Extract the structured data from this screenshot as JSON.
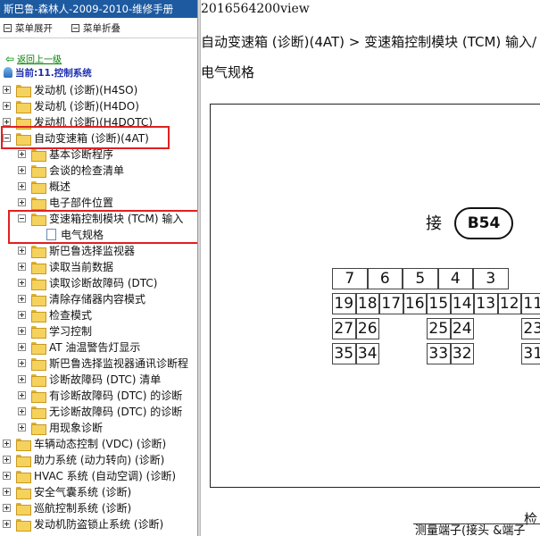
{
  "window": {
    "title": "斯巴鲁-森林人-2009-2010-维修手册"
  },
  "menubar": {
    "expand_label": "菜单展开",
    "collapse_label": "菜单折叠"
  },
  "nav": {
    "back_label": "返回上一级",
    "current_label": "当前:11.控制系统"
  },
  "tree": [
    {
      "label": "发动机 (诊断)(H4SO)",
      "level": 0,
      "type": "folder",
      "expander": "plus"
    },
    {
      "label": "发动机 (诊断)(H4DO)",
      "level": 0,
      "type": "folder",
      "expander": "plus"
    },
    {
      "label": "发动机 (诊断)(H4DOTC)",
      "level": 0,
      "type": "folder",
      "expander": "plus"
    },
    {
      "label": "自动变速箱 (诊断)(4AT)",
      "level": 0,
      "type": "folder",
      "expander": "minus"
    },
    {
      "label": "基本诊断程序",
      "level": 1,
      "type": "folder",
      "expander": "plus"
    },
    {
      "label": "会谈的检查清单",
      "level": 1,
      "type": "folder",
      "expander": "plus"
    },
    {
      "label": "概述",
      "level": 1,
      "type": "folder",
      "expander": "plus"
    },
    {
      "label": "电子部件位置",
      "level": 1,
      "type": "folder",
      "expander": "plus"
    },
    {
      "label": "变速箱控制模块 (TCM) 输入",
      "level": 1,
      "type": "folder",
      "expander": "minus"
    },
    {
      "label": "电气规格",
      "level": 2,
      "type": "page",
      "expander": "none"
    },
    {
      "label": "斯巴鲁选择监视器",
      "level": 1,
      "type": "folder",
      "expander": "plus"
    },
    {
      "label": "读取当前数据",
      "level": 1,
      "type": "folder",
      "expander": "plus"
    },
    {
      "label": "读取诊断故障码 (DTC)",
      "level": 1,
      "type": "folder",
      "expander": "plus"
    },
    {
      "label": "清除存储器内容模式",
      "level": 1,
      "type": "folder",
      "expander": "plus"
    },
    {
      "label": "检查模式",
      "level": 1,
      "type": "folder",
      "expander": "plus"
    },
    {
      "label": "学习控制",
      "level": 1,
      "type": "folder",
      "expander": "plus"
    },
    {
      "label": "AT 油温警告灯显示",
      "level": 1,
      "type": "folder",
      "expander": "plus"
    },
    {
      "label": "斯巴鲁选择监视器通讯诊断程",
      "level": 1,
      "type": "folder",
      "expander": "plus"
    },
    {
      "label": "诊断故障码 (DTC) 清单",
      "level": 1,
      "type": "folder",
      "expander": "plus"
    },
    {
      "label": "有诊断故障码 (DTC) 的诊断",
      "level": 1,
      "type": "folder",
      "expander": "plus"
    },
    {
      "label": "无诊断故障码 (DTC) 的诊断",
      "level": 1,
      "type": "folder",
      "expander": "plus"
    },
    {
      "label": "用现象诊断",
      "level": 1,
      "type": "folder",
      "expander": "plus"
    },
    {
      "label": "车辆动态控制 (VDC) (诊断)",
      "level": 0,
      "type": "folder",
      "expander": "plus"
    },
    {
      "label": "助力系统 (动力转向) (诊断)",
      "level": 0,
      "type": "folder",
      "expander": "plus"
    },
    {
      "label": "HVAC 系统 (自动空调) (诊断)",
      "level": 0,
      "type": "folder",
      "expander": "plus"
    },
    {
      "label": "安全气囊系统 (诊断)",
      "level": 0,
      "type": "folder",
      "expander": "plus"
    },
    {
      "label": "巡航控制系统 (诊断)",
      "level": 0,
      "type": "folder",
      "expander": "plus"
    },
    {
      "label": "发动机防盗锁止系统 (诊断)",
      "level": 0,
      "type": "folder",
      "expander": "plus"
    }
  ],
  "doc": {
    "id": "2016564200view",
    "breadcrumb": "自动变速箱 (诊断)(4AT) > 变速箱控制模块 (TCM) 输入/",
    "section_title": "电气规格",
    "connector_label": "接",
    "connector_id": "B54",
    "pin_rows": [
      [
        "7",
        "6",
        "5",
        "4",
        "3"
      ],
      [
        "19",
        "18",
        "17",
        "16",
        "15",
        "14",
        "13",
        "12",
        "11"
      ],
      [
        "27",
        "26",
        "25",
        "24",
        "23"
      ],
      [
        "35",
        "34",
        "33",
        "32",
        "31"
      ]
    ],
    "bottom_text": "检",
    "table_header": "测量端子(接头 &端子"
  },
  "colors": {
    "titlebar": "#1d5aa0",
    "highlight_box": "#e02020",
    "current_text": "#1c2eb0",
    "back_link": "#008000"
  }
}
